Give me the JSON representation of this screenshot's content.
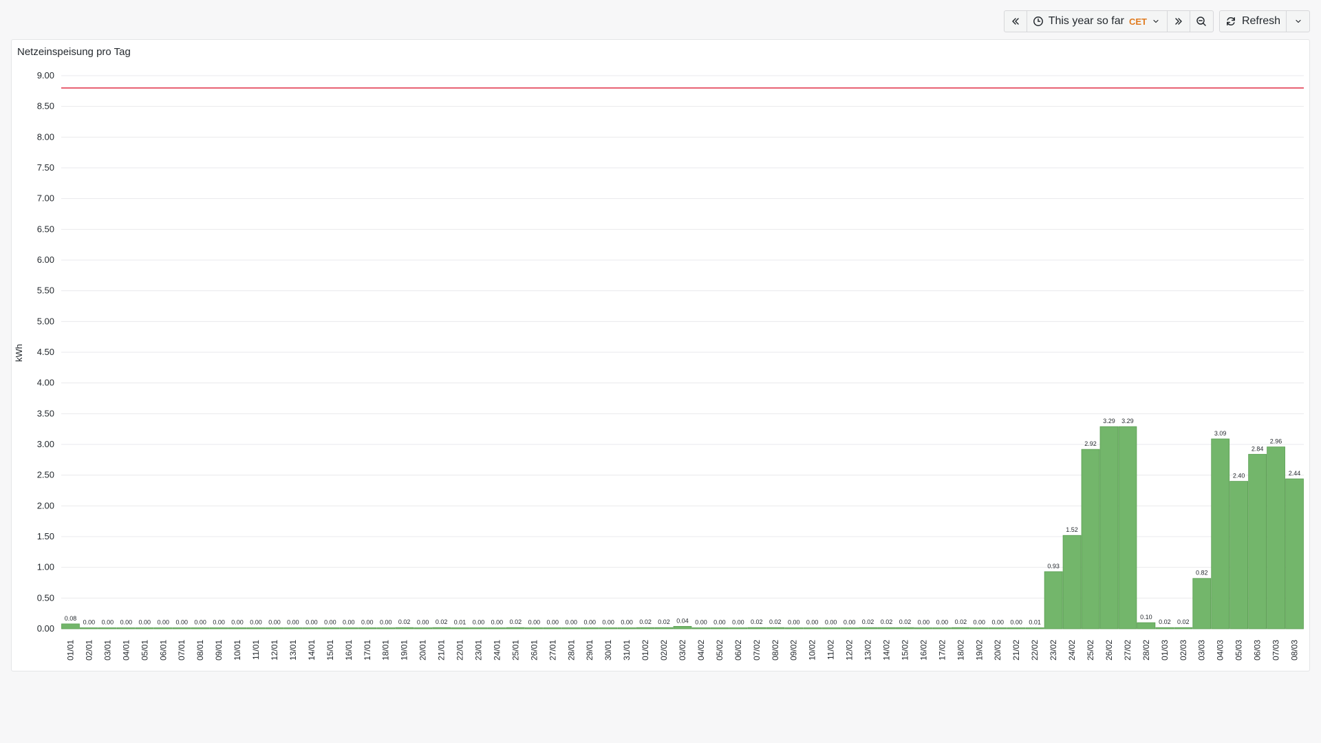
{
  "toolbar": {
    "time_range_label": "This year so far",
    "timezone": "CET",
    "refresh_label": "Refresh",
    "icons": [
      "chevrons-left-icon",
      "clock-icon",
      "chevron-down-icon",
      "chevrons-right-icon",
      "zoom-out-icon",
      "refresh-icon",
      "chevron-down-icon"
    ]
  },
  "panel": {
    "title": "Netzeinspeisung pro Tag"
  },
  "colors": {
    "bar_fill": "#73b66b",
    "bar_stroke": "#5a9e52",
    "threshold": "#e02f44",
    "grid": "#e9e9ec",
    "accent_tz": "#e07a1f"
  },
  "chart_data": {
    "type": "bar",
    "title": "Netzeinspeisung pro Tag",
    "xlabel": "",
    "ylabel": "kWh",
    "ylim": [
      0,
      9
    ],
    "yticks": [
      "0.00",
      "0.50",
      "1.00",
      "1.50",
      "2.00",
      "2.50",
      "3.00",
      "3.50",
      "4.00",
      "4.50",
      "5.00",
      "5.50",
      "6.00",
      "6.50",
      "7.00",
      "7.50",
      "8.00",
      "8.50",
      "9.00"
    ],
    "threshold": 8.8,
    "grid": true,
    "categories": [
      "01/01",
      "02/01",
      "03/01",
      "04/01",
      "05/01",
      "06/01",
      "07/01",
      "08/01",
      "09/01",
      "10/01",
      "11/01",
      "12/01",
      "13/01",
      "14/01",
      "15/01",
      "16/01",
      "17/01",
      "18/01",
      "19/01",
      "20/01",
      "21/01",
      "22/01",
      "23/01",
      "24/01",
      "25/01",
      "26/01",
      "27/01",
      "28/01",
      "29/01",
      "30/01",
      "31/01",
      "01/02",
      "02/02",
      "03/02",
      "04/02",
      "05/02",
      "06/02",
      "07/02",
      "08/02",
      "09/02",
      "10/02",
      "11/02",
      "12/02",
      "13/02",
      "14/02",
      "15/02",
      "16/02",
      "17/02",
      "18/02",
      "19/02",
      "20/02",
      "21/02",
      "22/02",
      "23/02",
      "24/02",
      "25/02",
      "26/02",
      "27/02",
      "28/02",
      "01/03",
      "02/03",
      "03/03",
      "04/03",
      "05/03",
      "06/03",
      "07/03",
      "08/03"
    ],
    "values": [
      0.08,
      0.0,
      0.0,
      0.0,
      0.0,
      0.0,
      0.0,
      0.0,
      0.0,
      0.0,
      0.0,
      0.0,
      0.0,
      0.0,
      0.0,
      0.0,
      0.0,
      0.0,
      0.02,
      0.0,
      0.02,
      0.01,
      0.0,
      0.0,
      0.02,
      0.0,
      0.0,
      0.0,
      0.0,
      0.0,
      0.0,
      0.02,
      0.02,
      0.04,
      0.0,
      0.0,
      0.0,
      0.02,
      0.02,
      0.0,
      0.0,
      0.0,
      0.0,
      0.02,
      0.02,
      0.02,
      0.0,
      0.0,
      0.02,
      0.0,
      0.0,
      0.0,
      0.01,
      0.93,
      1.52,
      2.92,
      3.29,
      3.29,
      0.1,
      0.02,
      0.02,
      0.82,
      3.09,
      2.4,
      2.84,
      2.96,
      2.44
    ],
    "value_labels": [
      "0.08",
      "0.00",
      "0.00",
      "0.00",
      "0.00",
      "0.00",
      "0.00",
      "0.00",
      "0.00",
      "0.00",
      "0.00",
      "0.00",
      "0.00",
      "0.00",
      "0.00",
      "0.00",
      "0.00",
      "0.00",
      "0.02",
      "0.00",
      "0.02",
      "0.01",
      "0.00",
      "0.00",
      "0.02",
      "0.00",
      "0.00",
      "0.00",
      "0.00",
      "0.00",
      "0.00",
      "0.02",
      "0.02",
      "0.04",
      "0.00",
      "0.00",
      "0.00",
      "0.02",
      "0.02",
      "0.00",
      "0.00",
      "0.00",
      "0.00",
      "0.02",
      "0.02",
      "0.02",
      "0.00",
      "0.00",
      "0.02",
      "0.00",
      "0.00",
      "0.00",
      "0.01",
      "0.93",
      "1.52",
      "2.92",
      "3.29",
      "3.29",
      "0.10",
      "0.02",
      "0.02",
      "0.82",
      "3.09",
      "2.40",
      "2.84",
      "2.96",
      "2.44"
    ]
  }
}
